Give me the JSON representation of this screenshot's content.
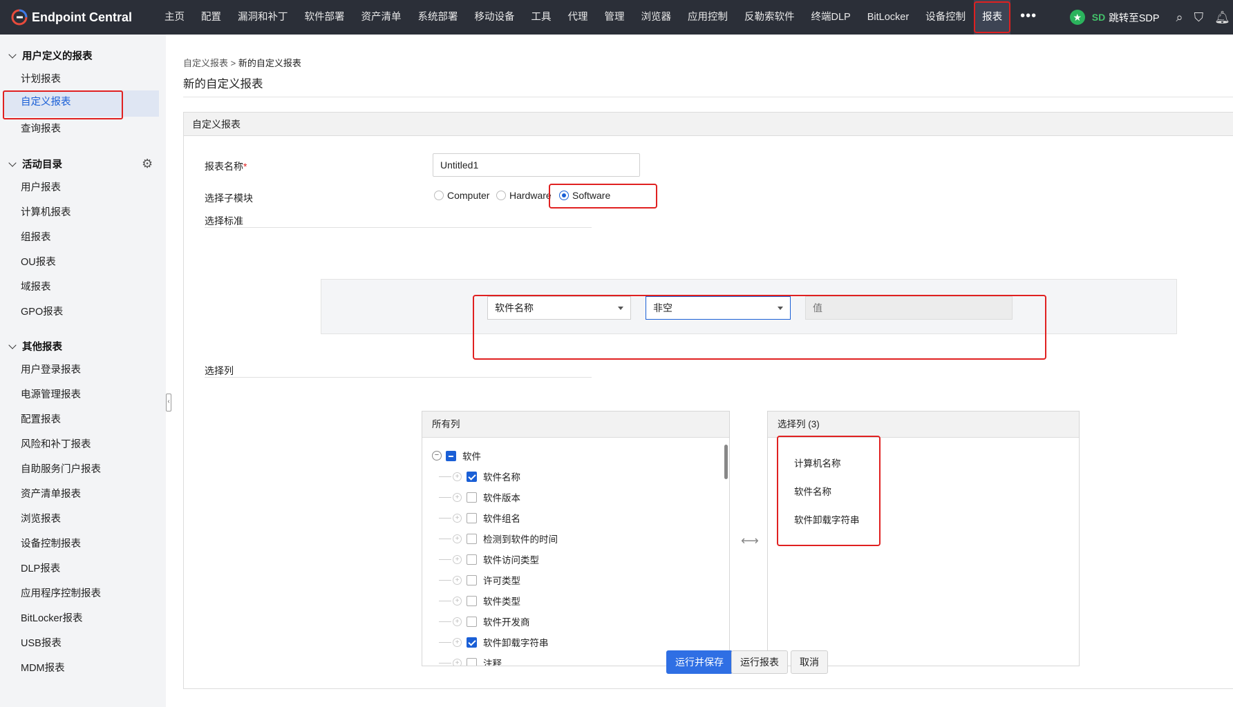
{
  "brand": {
    "name": "Endpoint Central"
  },
  "nav": {
    "items": [
      "主页",
      "配置",
      "漏洞和补丁",
      "软件部署",
      "资产清单",
      "系统部署",
      "移动设备",
      "工具",
      "代理",
      "管理",
      "浏览器",
      "应用控制",
      "反勒索软件",
      "终端DLP",
      "BitLocker",
      "设备控制",
      "报表"
    ],
    "active": "报表",
    "more": "•••",
    "sdp_link": "跳转至SDP"
  },
  "sidebar": {
    "sections": [
      {
        "title": "用户定义的报表",
        "items": [
          "计划报表",
          "自定义报表",
          "查询报表"
        ]
      },
      {
        "title": "活动目录",
        "items": [
          "用户报表",
          "计算机报表",
          "组报表",
          "OU报表",
          "域报表",
          "GPO报表"
        ]
      },
      {
        "title": "其他报表",
        "items": [
          "用户登录报表",
          "电源管理报表",
          "配置报表",
          "风险和补丁报表",
          "自助服务门户报表",
          "资产清单报表",
          "浏览报表",
          "设备控制报表",
          "DLP报表",
          "应用程序控制报表",
          "BitLocker报表",
          "USB报表",
          "MDM报表"
        ]
      }
    ],
    "active_item": "自定义报表"
  },
  "breadcrumb": {
    "parent": "自定义报表",
    "separator": ">",
    "current": "新的自定义报表"
  },
  "page": {
    "title": "新的自定义报表",
    "panel_title": "自定义报表"
  },
  "form": {
    "name_label": "报表名称",
    "required_mark": "*",
    "name_value": "Untitled1",
    "submodule_label": "选择子模块",
    "submodules": [
      "Computer",
      "Hardware",
      "Software"
    ],
    "selected_submodule": "Software",
    "criteria_label": "选择标准",
    "criteria": {
      "field": "软件名称",
      "operator": "非空",
      "value_placeholder": "值"
    },
    "columns_label": "选择列"
  },
  "columns": {
    "all_title": "所有列",
    "tree_root": "软件",
    "tree_items": [
      {
        "label": "软件名称",
        "checked": true
      },
      {
        "label": "软件版本",
        "checked": false
      },
      {
        "label": "软件组名",
        "checked": false
      },
      {
        "label": "检测到软件的时间",
        "checked": false
      },
      {
        "label": "软件访问类型",
        "checked": false
      },
      {
        "label": "许可类型",
        "checked": false
      },
      {
        "label": "软件类型",
        "checked": false
      },
      {
        "label": "软件开发商",
        "checked": false
      },
      {
        "label": "软件卸载字符串",
        "checked": true
      },
      {
        "label": "注释",
        "checked": false
      }
    ],
    "selected_title": "选择列 (3)",
    "selected_items": [
      "计算机名称",
      "软件名称",
      "软件卸载字符串"
    ]
  },
  "buttons": {
    "run_save": "运行并保存",
    "run": "运行报表",
    "cancel": "取消"
  },
  "colors": {
    "topbar": "#2b2f38",
    "accent": "#2f6fe4",
    "highlight": "#e02020",
    "sidebar_bg": "#f3f4f6"
  }
}
